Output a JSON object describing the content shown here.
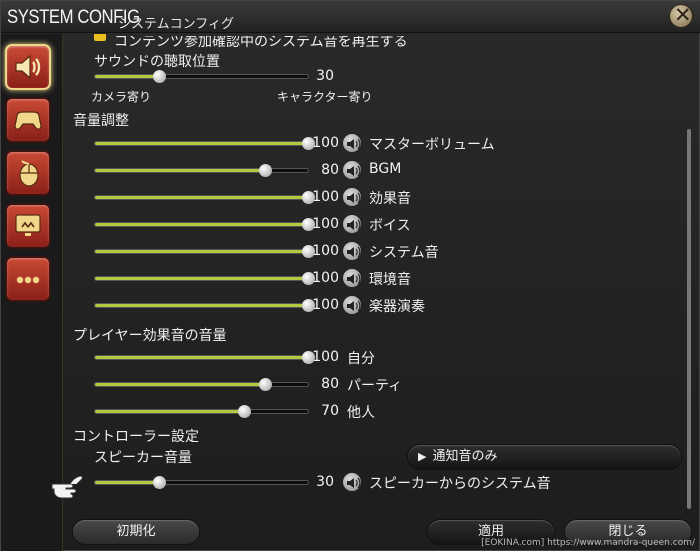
{
  "window": {
    "title_en": "SYSTEM CONFIG",
    "title_jp": "システムコンフィグ"
  },
  "sidebar": {
    "items": [
      {
        "icon": "speaker-icon",
        "active": true
      },
      {
        "icon": "gamepad-icon",
        "active": false
      },
      {
        "icon": "mouse-icon",
        "active": false
      },
      {
        "icon": "monitor-icon",
        "active": false
      },
      {
        "icon": "more-icon",
        "active": false
      }
    ]
  },
  "top_partial_text": "コンテンツ参加確認中のシステム音を再生する",
  "listening_position": {
    "label": "サウンドの聴取位置",
    "value": "30",
    "left_label": "カメラ寄り",
    "right_label": "キャラクター寄り"
  },
  "volume": {
    "heading": "音量調整",
    "rows": [
      {
        "value": "100",
        "label": "マスターボリューム",
        "level": 100
      },
      {
        "value": "80",
        "label": "BGM",
        "level": 80
      },
      {
        "value": "100",
        "label": "効果音",
        "level": 100
      },
      {
        "value": "100",
        "label": "ボイス",
        "level": 100
      },
      {
        "value": "100",
        "label": "システム音",
        "level": 100
      },
      {
        "value": "100",
        "label": "環境音",
        "level": 100
      },
      {
        "value": "100",
        "label": "楽器演奏",
        "level": 100
      }
    ]
  },
  "player_effects": {
    "heading": "プレイヤー効果音の音量",
    "rows": [
      {
        "value": "100",
        "label": "自分",
        "level": 100
      },
      {
        "value": "80",
        "label": "パーティ",
        "level": 80
      },
      {
        "value": "70",
        "label": "他人",
        "level": 70
      }
    ]
  },
  "controller": {
    "heading": "コントローラー設定",
    "speaker_volume_label": "スピーカー音量",
    "notify_button": "通知音のみ",
    "speaker_value": "30",
    "speaker_level": 30,
    "speaker_system_label": "スピーカーからのシステム音"
  },
  "footer": {
    "reset": "初期化",
    "apply": "適用",
    "close": "閉じる"
  },
  "watermark": "[EOKINA.com]  https://www.mandra-queen.com/",
  "colors": {
    "slider_fill": "#b4c840",
    "sidebar_button": "#b8392a",
    "active_highlight": "#f0d88a"
  }
}
